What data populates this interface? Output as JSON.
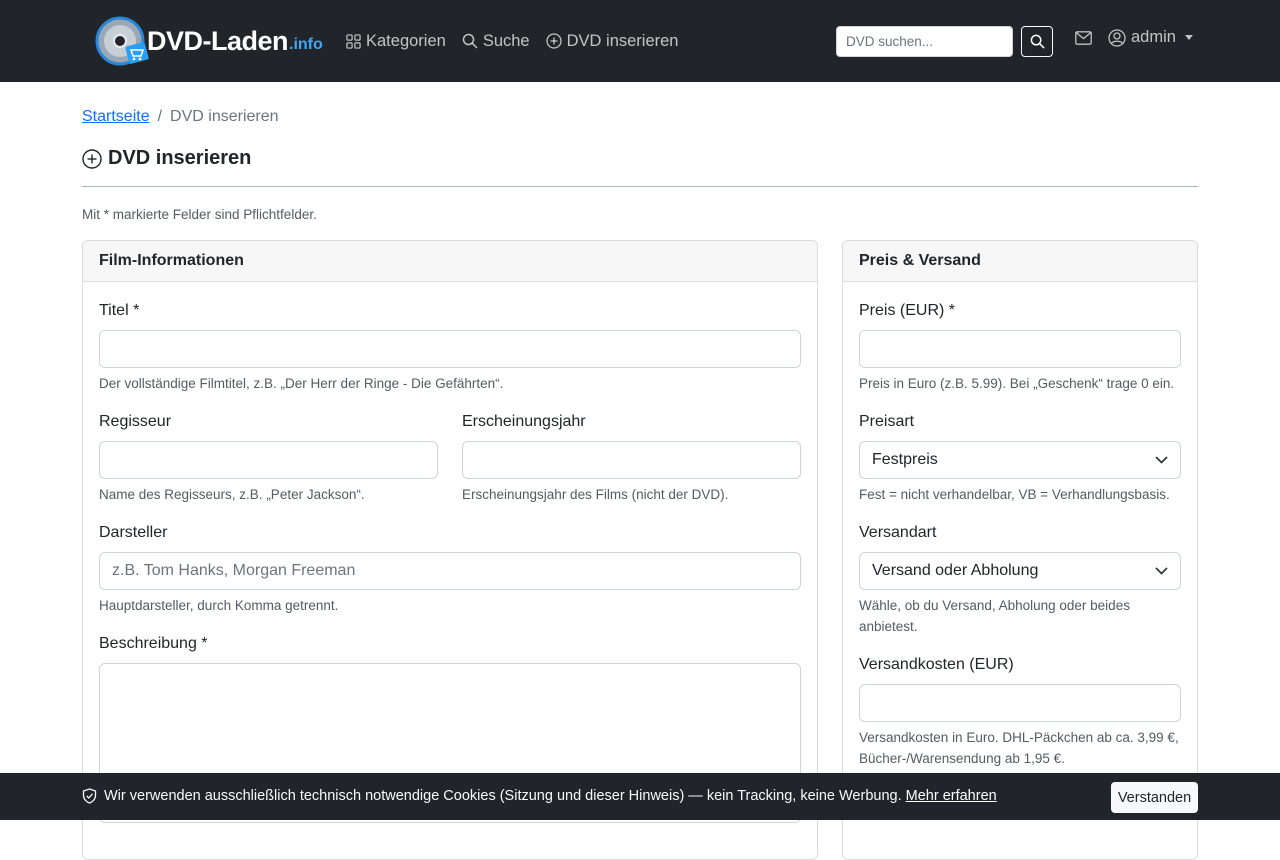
{
  "brand": {
    "name": "DVD-Laden",
    "suffix": ".info"
  },
  "nav": {
    "links": [
      "Kategorien",
      "Suche",
      "DVD inserieren"
    ],
    "search_placeholder": "DVD suchen...",
    "user": "admin"
  },
  "breadcrumb": {
    "home": "Startseite",
    "current": "DVD inserieren"
  },
  "page": {
    "title": "DVD inserieren",
    "required_note": "Mit * markierte Felder sind Pflichtfelder."
  },
  "film": {
    "header": "Film-Informationen",
    "title_label": "Titel *",
    "title_help": "Der vollständige Filmtitel, z.B. „Der Herr der Ringe - Die Gefährten“.",
    "director_label": "Regisseur",
    "director_help": "Name des Regisseurs, z.B. „Peter Jackson“.",
    "year_label": "Erscheinungsjahr",
    "year_help": "Erscheinungsjahr des Films (nicht der DVD).",
    "actors_label": "Darsteller",
    "actors_placeholder": "z.B. Tom Hanks, Morgan Freeman",
    "actors_help": "Hauptdarsteller, durch Komma getrennt.",
    "description_label": "Beschreibung *"
  },
  "price": {
    "header": "Preis & Versand",
    "price_label": "Preis (EUR) *",
    "price_help": "Preis in Euro (z.B. 5.99). Bei „Geschenk“ trage 0 ein.",
    "price_type_label": "Preisart",
    "price_type_value": "Festpreis",
    "price_type_help": "Fest = nicht verhandelbar, VB = Verhandlungsbasis.",
    "shipping_type_label": "Versandart",
    "shipping_type_value": "Versand oder Abholung",
    "shipping_type_help_1": "Wähle, ob du Versand, Abholung oder beides",
    "shipping_type_help_2": "anbietest.",
    "shipping_cost_label": "Versandkosten (EUR)",
    "shipping_cost_help_1": "Versandkosten in Euro. DHL-Päckchen ab ca. 3,99 €,",
    "shipping_cost_help_2": "Bücher-/Warensendung ab 1,95 €."
  },
  "cookie": {
    "text": "Wir verwenden ausschließlich technisch notwendige Cookies (Sitzung und dieser Hinweis) — kein Tracking, keine Werbung.",
    "link": "Mehr erfahren",
    "button": "Verstanden"
  },
  "colors": {
    "navbar": "#212529",
    "link": "#0d6efd",
    "brand_accent": "#3ea8f5"
  },
  "icons": [
    "dvd-logo-icon",
    "grid-icon",
    "search-icon",
    "plus-circle-icon",
    "mail-icon",
    "user-circle-icon",
    "chevron-down-icon",
    "shield-check-icon"
  ]
}
